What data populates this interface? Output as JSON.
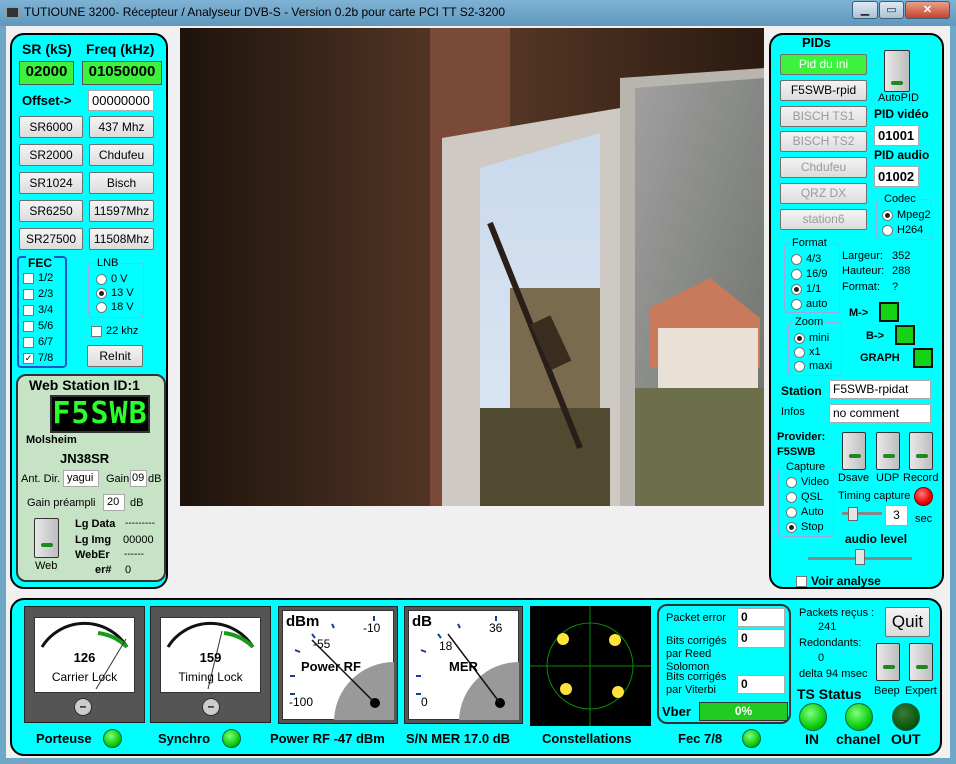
{
  "window": {
    "title": "TUTIOUNE 3200-  Récepteur / Analyseur DVB-S - Version 0.2b pour carte PCI TT S2-3200",
    "minimize": "▁",
    "maximize": "▭",
    "close": "✕"
  },
  "left": {
    "sr_label": "SR (kS)",
    "freq_label": "Freq (kHz)",
    "sr_value": "02000",
    "freq_value": "01050000",
    "offset_label": "Offset->",
    "offset_value": "00000000",
    "sr_buttons": [
      "SR6000",
      "SR2000",
      "SR1024",
      "SR6250",
      "SR27500"
    ],
    "freq_buttons": [
      "437 Mhz",
      "Chdufeu",
      "Bisch",
      "11597Mhz",
      "11508Mhz"
    ],
    "fec_title": "FEC",
    "fec_options": [
      {
        "label": "1/2",
        "checked": false
      },
      {
        "label": "2/3",
        "checked": false
      },
      {
        "label": "3/4",
        "checked": false
      },
      {
        "label": "5/6",
        "checked": false
      },
      {
        "label": "6/7",
        "checked": false
      },
      {
        "label": "7/8",
        "checked": true
      }
    ],
    "lnb_title": "LNB",
    "lnb_options": [
      {
        "label": "0 V",
        "selected": false
      },
      {
        "label": "13 V",
        "selected": true
      },
      {
        "label": "18 V",
        "selected": false
      }
    ],
    "khz_label": "22 khz",
    "reinit_label": "ReInit"
  },
  "station": {
    "title": "Web Station ID:1",
    "callsign": "F5SWB",
    "city": "Molsheim",
    "locator": "JN38SR",
    "ant_dir_label": "Ant. Dir.",
    "ant_dir_value": "yagui",
    "gain_label": "Gain",
    "gain_value": "09",
    "gain_unit": "dB",
    "preamp_label": "Gain préampli",
    "preamp_value": "20",
    "preamp_unit": "dB",
    "web_label": "Web",
    "lg_data_label": "Lg Data",
    "lg_data_value": "---------",
    "lg_img_label": "Lg Img",
    "lg_img_value": "00000",
    "weber_label": "WebEr",
    "weber_value": "------",
    "err_label": "er#",
    "err_value": "0"
  },
  "pids": {
    "title": "PIDs",
    "buttons": [
      {
        "label": "Pid du  ini",
        "active": true
      },
      {
        "label": "F5SWB-rpid",
        "active": false
      },
      {
        "label": "BISCH TS1",
        "active": false
      },
      {
        "label": "BISCH TS2",
        "active": false
      },
      {
        "label": "Chdufeu",
        "active": false
      },
      {
        "label": "QRZ DX",
        "active": false
      },
      {
        "label": "station6",
        "active": false
      }
    ],
    "autopid_label": "AutoPID",
    "pid_video_label": "PID vidéo",
    "pid_video_value": "01001",
    "pid_audio_label": "PID audio",
    "pid_audio_value": "01002",
    "codec_title": "Codec",
    "codec_options": [
      {
        "label": "Mpeg2",
        "selected": true
      },
      {
        "label": "H264",
        "selected": false
      }
    ],
    "format_title": "Format",
    "format_options": [
      {
        "label": "4/3",
        "selected": false
      },
      {
        "label": "16/9",
        "selected": false
      },
      {
        "label": "1/1",
        "selected": true
      },
      {
        "label": "auto",
        "selected": false
      }
    ],
    "largeur_label": "Largeur:",
    "largeur_value": "352",
    "hauteur_label": "Hauteur:",
    "hauteur_value": "288",
    "format_label": "Format:",
    "format_value": "?",
    "m_label": "M->",
    "b_label": "B->",
    "graph_label": "GRAPH",
    "zoom_title": "Zoom",
    "zoom_options": [
      {
        "label": "mini",
        "selected": true
      },
      {
        "label": "x1",
        "selected": false
      },
      {
        "label": "maxi",
        "selected": false
      }
    ],
    "station_label": "Station",
    "station_value": "F5SWB-rpidat",
    "infos_label": "Infos",
    "infos_value": "no comment",
    "provider_label": "Provider:",
    "provider_value": "F5SWB",
    "capture_title": "Capture",
    "capture_options": [
      {
        "label": "Video",
        "selected": false
      },
      {
        "label": "QSL",
        "selected": false
      },
      {
        "label": "Auto",
        "selected": false
      },
      {
        "label": "Stop",
        "selected": true
      }
    ],
    "dsave_label": "Dsave",
    "udp_label": "UDP",
    "record_label": "Record",
    "timing_label": "Timing capture",
    "timing_value": "3",
    "sec_label": "sec",
    "audio_label": "audio level",
    "voir_label": "Voir analyse"
  },
  "bottom": {
    "carrier": {
      "value": "126",
      "label": "Carrier Lock"
    },
    "timing": {
      "value": "159",
      "label": "Timing Lock"
    },
    "power": {
      "unit": "dBm",
      "t1": "-55",
      "t2": "-10",
      "t3": "-100",
      "label": "Power RF"
    },
    "mer": {
      "unit": "dB",
      "t1": "18",
      "t2": "36",
      "t3": "0",
      "label": "MER"
    },
    "packet_error_label": "Packet error",
    "packet_error_value": "0",
    "rs_label": "Bits corrigés par Reed Solomon",
    "rs_value": "0",
    "viterbi_label": "Bits corrigés par Viterbi",
    "viterbi_value": "0",
    "vber_label": "Vber",
    "vber_value": "0%",
    "packets_label": "Packets reçus :",
    "packets_value": "241",
    "redondants_label": "Redondants:",
    "redondants_value": "0",
    "delta_label": "delta 94 msec",
    "quit_label": "Quit",
    "beep_label": "Beep",
    "expert_label": "Expert",
    "ts_status_label": "TS Status",
    "in_label": "IN",
    "chanel_label": "chanel",
    "out_label": "OUT",
    "porteuse_label": "Porteuse",
    "synchro_label": "Synchro",
    "power_rf_label": "Power RF -47 dBm",
    "snmer_label": "S/N MER  17.0 dB",
    "const_label": "Constellations",
    "fec_label": "Fec  7/8"
  }
}
